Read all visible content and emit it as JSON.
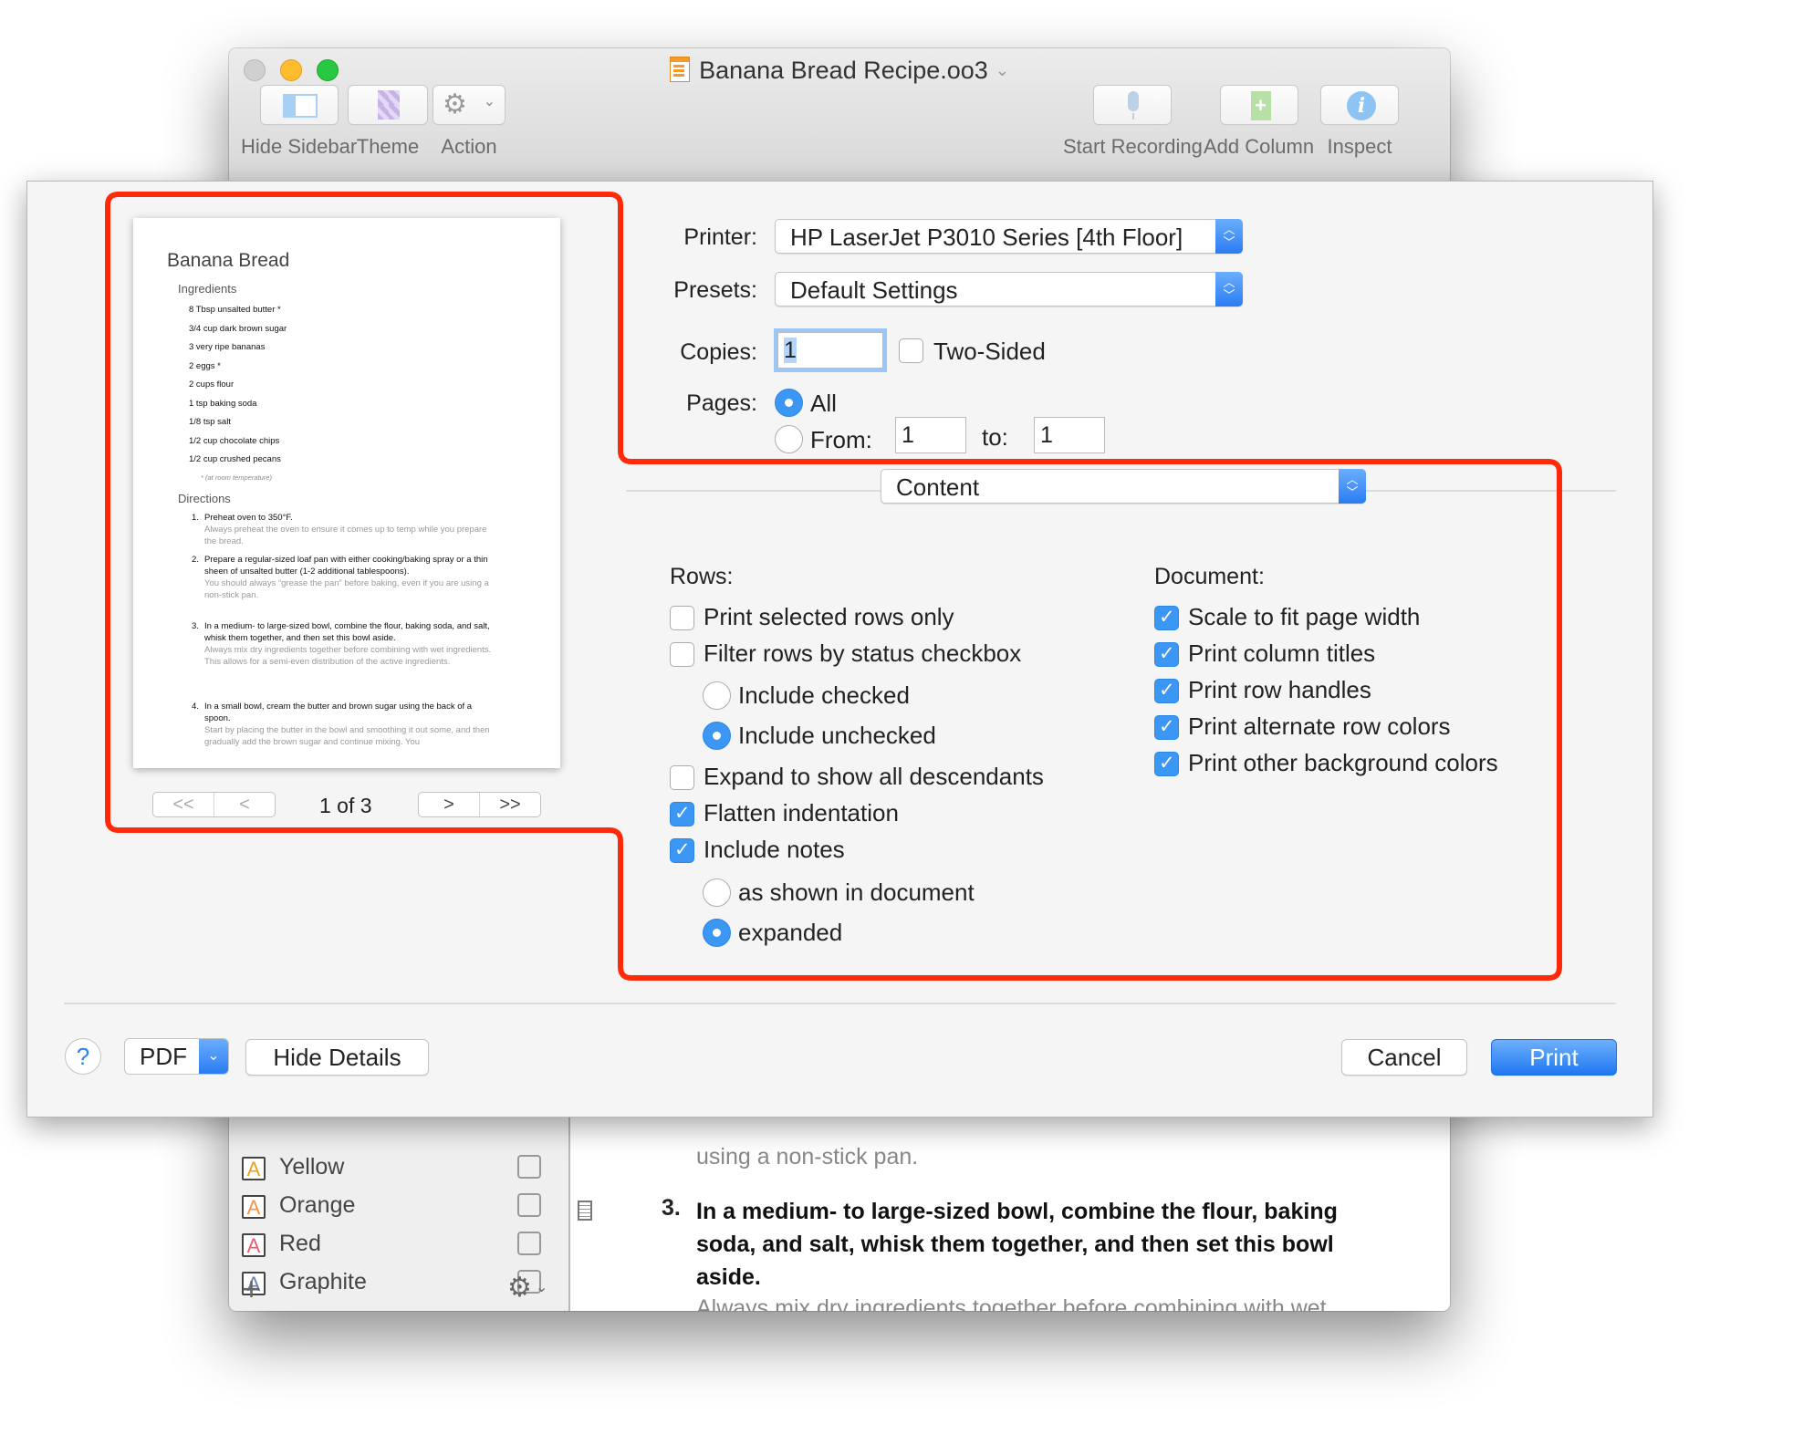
{
  "window": {
    "title": "Banana Bread Recipe.oo3",
    "toolbar": {
      "left": [
        {
          "label": "Hide Sidebar",
          "icon": "sidebar-icon"
        },
        {
          "label": "Theme",
          "icon": "theme-icon"
        },
        {
          "label": "Action",
          "icon": "gear-icon"
        }
      ],
      "right": [
        {
          "label": "Start Recording",
          "icon": "microphone-icon"
        },
        {
          "label": "Add Column",
          "icon": "add-column-icon"
        },
        {
          "label": "Inspect",
          "icon": "info-icon"
        }
      ]
    },
    "sidebar": {
      "styles": [
        {
          "name": "Yellow",
          "glyph": "A",
          "color": "#e8a21c",
          "checked": false
        },
        {
          "name": "Orange",
          "glyph": "A",
          "color": "#f5934a",
          "checked": false
        },
        {
          "name": "Red",
          "glyph": "A",
          "color": "#ee5a6e",
          "checked": false
        },
        {
          "name": "Graphite",
          "glyph": "A",
          "color": "#6d7fb3",
          "checked": false
        }
      ],
      "add_symbol": "+",
      "gear_symbol": "⚙",
      "chevron_symbol": "⌄"
    },
    "editor": {
      "cutoff_text": "using a non-stick pan.",
      "step": {
        "number": "3.",
        "text": "In a medium- to large-sized bowl, combine the flour, baking soda, and salt, whisk them together, and then set this bowl aside.",
        "note": "Always mix dry ingredients together before combining with wet ingredients. This allows for a semi-even distribution of the active"
      }
    }
  },
  "print_dialog": {
    "preview": {
      "title": "Banana Bread",
      "ingredients_heading": "Ingredients",
      "ingredients": [
        "8 Tbsp unsalted butter *",
        "3/4 cup dark brown sugar",
        "3 very ripe bananas",
        "2 eggs *",
        "2 cups flour",
        "1 tsp baking soda",
        "1/8 tsp salt",
        "1/2 cup chocolate chips",
        "1/2 cup crushed pecans"
      ],
      "footnote": "* (at room temperature)",
      "directions_heading": "Directions",
      "steps": [
        {
          "n": "1.",
          "bold": "Preheat oven to 350°F.",
          "note": "Always preheat the oven to ensure it comes up to temp while you prepare the bread."
        },
        {
          "n": "2.",
          "bold": "Prepare a regular-sized loaf pan with either cooking/baking spray or a thin sheen of unsalted butter (1-2 additional tablespoons).",
          "note": "You should always “grease the pan” before baking, even if you are using a non-stick pan."
        },
        {
          "n": "3.",
          "bold": "In a medium- to large-sized bowl, combine the flour, baking soda, and salt, whisk them together, and then set this bowl aside.",
          "note": "Always mix dry ingredients together before combining with wet ingredients. This allows for a semi-even distribution of the active ingredients."
        },
        {
          "n": "4.",
          "bold": "In a small bowl, cream the butter and brown sugar using the back of a spoon.",
          "note": "Start by placing the butter in the bowl and smoothing it out some, and then gradually add the brown sugar and continue mixing. You"
        }
      ],
      "pager": {
        "first": "<<",
        "prev": "<",
        "next": ">",
        "last": ">>",
        "page_label": "1 of 3",
        "current_page": 1,
        "total_pages": 3
      }
    },
    "printer_label": "Printer:",
    "printer_value": "HP LaserJet P3010 Series [4th Floor]",
    "presets_label": "Presets:",
    "presets_value": "Default Settings",
    "copies_label": "Copies:",
    "copies_value": "1",
    "two_sided_label": "Two-Sided",
    "two_sided_checked": false,
    "pages_label": "Pages:",
    "pages_all_label": "All",
    "pages_from_label": "From:",
    "pages_from_value": "1",
    "pages_to_label": "to:",
    "pages_to_value": "1",
    "pages_selected": "All",
    "section_popup_value": "Content",
    "rows": {
      "heading": "Rows:",
      "print_selected_only": {
        "label": "Print selected rows only",
        "checked": false
      },
      "filter_by_status": {
        "label": "Filter rows by status checkbox",
        "checked": false
      },
      "include_checked": {
        "label": "Include checked",
        "selected": false
      },
      "include_unchecked": {
        "label": "Include unchecked",
        "selected": true
      },
      "expand_descendants": {
        "label": "Expand to show all descendants",
        "checked": false
      },
      "flatten_indentation": {
        "label": "Flatten indentation",
        "checked": true
      },
      "include_notes": {
        "label": "Include notes",
        "checked": true
      },
      "notes_as_shown": {
        "label": "as shown in document",
        "selected": false
      },
      "notes_expanded": {
        "label": "expanded",
        "selected": true
      }
    },
    "document": {
      "heading": "Document:",
      "options": [
        {
          "label": "Scale to fit page width",
          "checked": true
        },
        {
          "label": "Print column titles",
          "checked": true
        },
        {
          "label": "Print row handles",
          "checked": true
        },
        {
          "label": "Print alternate row colors",
          "checked": true
        },
        {
          "label": "Print other background colors",
          "checked": true
        }
      ]
    },
    "footer": {
      "help_symbol": "?",
      "pdf_label": "PDF",
      "hide_details_label": "Hide Details",
      "cancel_label": "Cancel",
      "print_label": "Print"
    }
  },
  "colors": {
    "accent": "#2a7cf3",
    "annotation": "#ff2a0a"
  }
}
